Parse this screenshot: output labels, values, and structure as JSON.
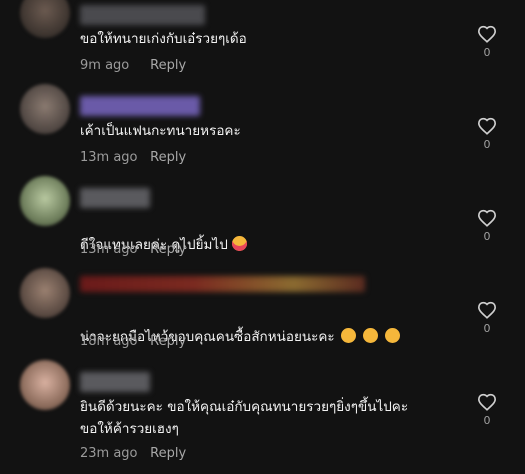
{
  "comments": [
    {
      "text": "ขอให้ทนายเก่งกับเอ๋รวยๆเด้อ",
      "time": "9m ago",
      "reply": "Reply",
      "likes": "0",
      "emojis": []
    },
    {
      "text": "เค้าเป็นแฟนกะทนายหรอคะ",
      "time": "13m ago",
      "reply": "Reply",
      "likes": "0",
      "emojis": []
    },
    {
      "text": "ดีใจแทนเลยค่ะ ดูไปยิ้มไป",
      "time": "13m ago",
      "reply": "Reply",
      "likes": "0",
      "emojis": [
        "heart-eyes-emoji"
      ]
    },
    {
      "text": "น่าจะยกมือไหว้ขอบคุณคนซื้อสักหน่อยนะคะ",
      "time": "18m ago",
      "reply": "Reply",
      "likes": "0",
      "emojis": [
        "smile-emoji",
        "smile-emoji",
        "smile-emoji"
      ]
    },
    {
      "text": "ยินดีด้วยนะคะ ขอให้คุณเอ๋กับคุณทนายรวยๆยิ่งๆขึ้นไปคะ\nขอให้ค้ารวยเฮงๆ",
      "time": "23m ago",
      "reply": "Reply",
      "likes": "0",
      "emojis": []
    }
  ],
  "colors": {
    "background": "#121212",
    "emoji": "#f5b73b",
    "emoji_heart": "#e8455a"
  }
}
